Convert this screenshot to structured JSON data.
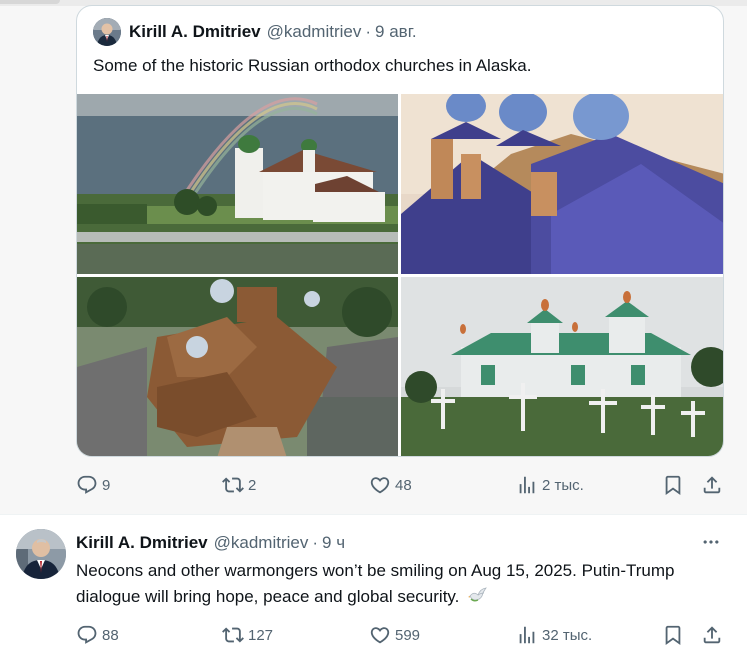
{
  "quoted_tweet": {
    "author_name": "Kirill A. Dmitriev",
    "author_handle": "@kadmitriev",
    "separator": "·",
    "time": "9 авг.",
    "text": "Some of the historic Russian orthodox churches in Alaska.",
    "images": [
      {
        "icon": "church-with-rainbow-photo"
      },
      {
        "icon": "blue-onion-domes-photo"
      },
      {
        "icon": "wooden-church-aerial-photo"
      },
      {
        "icon": "green-roof-church-cemetery-photo"
      }
    ],
    "actions": {
      "replies": "9",
      "reposts": "2",
      "likes": "48",
      "views": "2 тыс."
    }
  },
  "tweet": {
    "author_name": "Kirill A. Dmitriev",
    "author_handle": "@kadmitriev",
    "separator": "·",
    "time": "9 ч",
    "text": "Neocons and other warmongers won’t be smiling on Aug 15, 2025. Putin-Trump dialogue will bring hope, peace and global security.",
    "emoji": "dove-emoji",
    "actions": {
      "replies": "88",
      "reposts": "127",
      "likes": "599",
      "views": "32 тыс."
    }
  },
  "colors": {
    "text": "#0f1419",
    "secondary": "#536471",
    "border": "#cfd9de"
  }
}
